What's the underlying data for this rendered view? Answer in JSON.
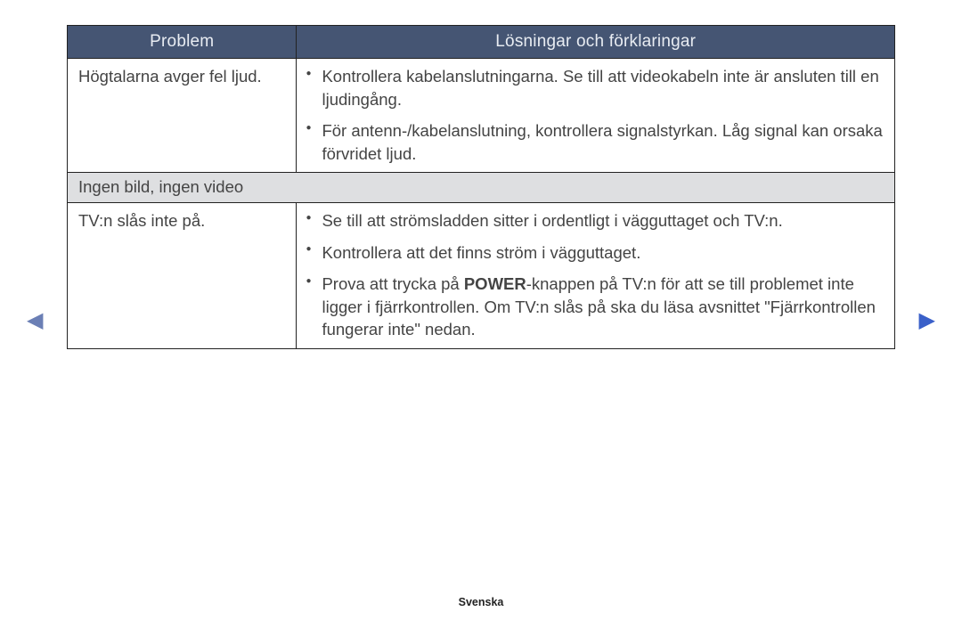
{
  "table": {
    "header": {
      "problem": "Problem",
      "solution": "Lösningar och förklaringar"
    },
    "rows": [
      {
        "problem": "Högtalarna avger fel ljud.",
        "solutions": [
          "Kontrollera kabelanslutningarna. Se till att videokabeln inte är ansluten till en ljudingång.",
          "För antenn-/kabelanslutning, kontrollera signalstyrkan. Låg signal kan orsaka förvridet ljud."
        ]
      }
    ],
    "section_label": "Ingen bild, ingen video",
    "rows2": [
      {
        "problem": "TV:n slås inte på.",
        "solutions": [
          "Se till att strömsladden sitter i ordentligt i vägguttaget och TV:n.",
          "Kontrollera att det finns ström i vägguttaget."
        ],
        "solution3_pre": "Prova att trycka på ",
        "solution3_bold": "POWER",
        "solution3_post": "-knappen på TV:n för att se till problemet inte ligger i fjärrkontrollen. Om TV:n slås på ska du läsa avsnittet \"Fjärrkontrollen fungerar inte\" nedan."
      }
    ]
  },
  "nav": {
    "left": "◀",
    "right": "▶"
  },
  "footer": {
    "language": "Svenska"
  }
}
